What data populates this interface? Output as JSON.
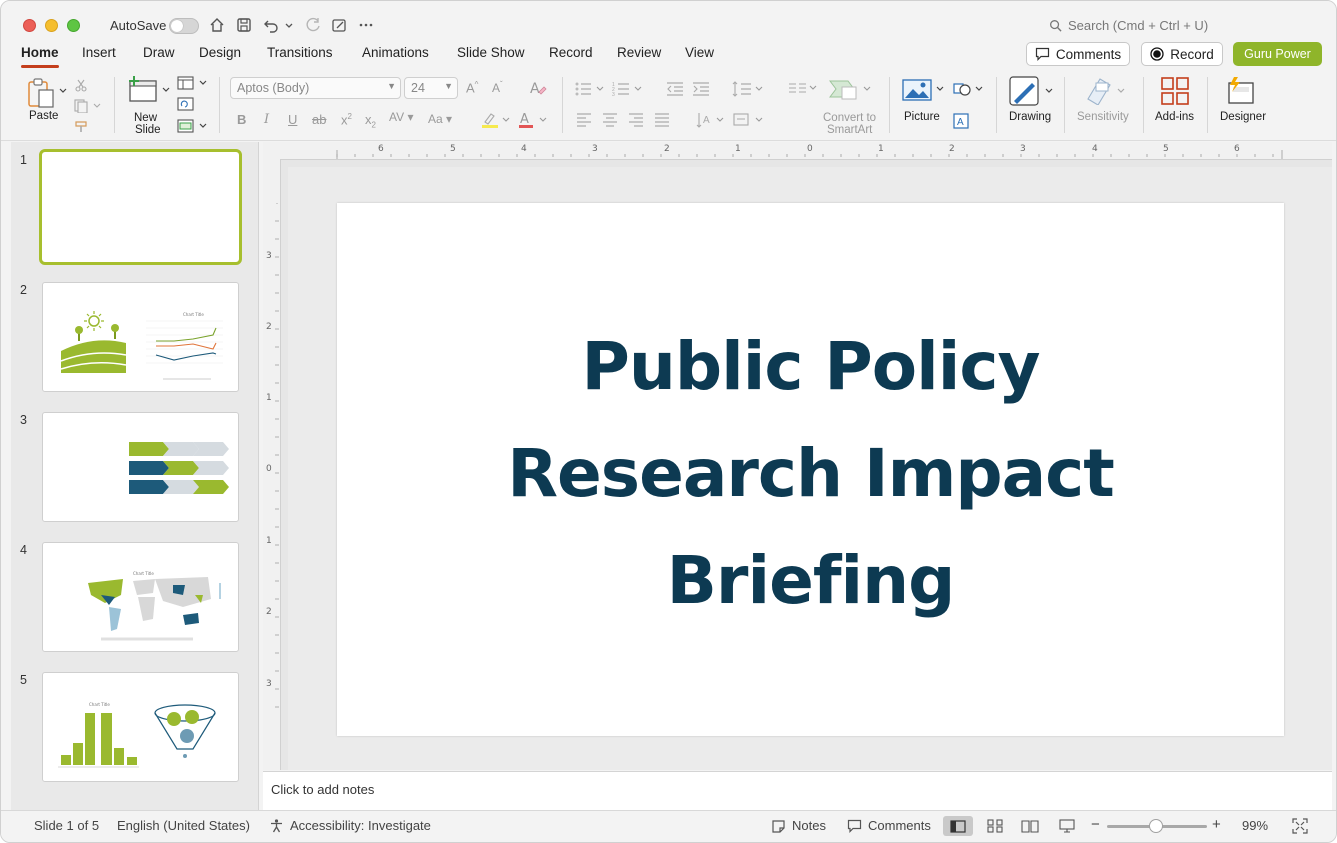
{
  "titlebar": {
    "autosave_label": "AutoSave",
    "search_placeholder": "Search (Cmd + Ctrl + U)"
  },
  "tabs": [
    {
      "label": "Home",
      "active": true
    },
    {
      "label": "Insert"
    },
    {
      "label": "Draw"
    },
    {
      "label": "Design"
    },
    {
      "label": "Transitions"
    },
    {
      "label": "Animations"
    },
    {
      "label": "Slide Show"
    },
    {
      "label": "Record"
    },
    {
      "label": "Review"
    },
    {
      "label": "View"
    }
  ],
  "actions": {
    "comments": "Comments",
    "record": "Record",
    "guru": "Guru Power"
  },
  "ribbon": {
    "paste": "Paste",
    "new_slide_1": "New",
    "new_slide_2": "Slide",
    "font_name": "Aptos (Body)",
    "font_size": "24",
    "convert_1": "Convert to",
    "convert_2": "SmartArt",
    "picture": "Picture",
    "drawing": "Drawing",
    "sensitivity": "Sensitivity",
    "addins": "Add-ins",
    "designer": "Designer"
  },
  "thumbnails": [
    {
      "num": "1"
    },
    {
      "num": "2",
      "chart_title": "Chart Title"
    },
    {
      "num": "3"
    },
    {
      "num": "4",
      "chart_title": "Chart Title"
    },
    {
      "num": "5",
      "chart_title": "Chart Title"
    }
  ],
  "slide": {
    "title_line1": "Public Policy",
    "title_line2": "Research Impact",
    "title_line3": "Briefing"
  },
  "ruler": {
    "h_labels": [
      "6",
      "5",
      "4",
      "3",
      "2",
      "1",
      "0",
      "1",
      "2",
      "3",
      "4",
      "5",
      "6"
    ],
    "v_labels": [
      "3",
      "2",
      "1",
      "0",
      "1",
      "2",
      "3"
    ]
  },
  "notes": {
    "placeholder": "Click to add notes"
  },
  "status": {
    "slide_info": "Slide 1 of 5",
    "language": "English (United States)",
    "accessibility": "Accessibility: Investigate",
    "notes": "Notes",
    "comments": "Comments",
    "zoom": "99%"
  },
  "colors": {
    "title": "#0d3a52",
    "accent_green": "#8fb52a",
    "accent_red": "#c43e1c"
  }
}
